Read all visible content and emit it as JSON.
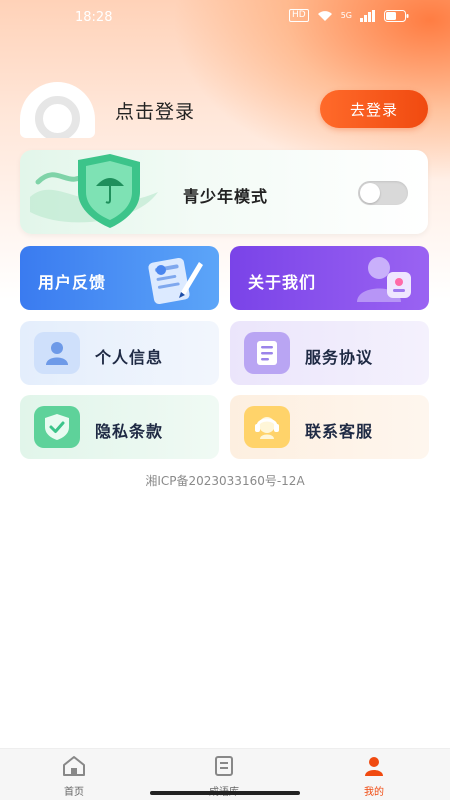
{
  "status_bar": {
    "time": "18:28",
    "hd_badge": "HD",
    "network_label": "5G"
  },
  "profile": {
    "login_prompt": "点击登录",
    "login_button": "去登录"
  },
  "youth_mode": {
    "label": "青少年模式",
    "enabled": false
  },
  "menu": {
    "feedback": "用户反馈",
    "about": "关于我们",
    "personal_info": "个人信息",
    "service_agreement": "服务协议",
    "privacy": "隐私条款",
    "contact": "联系客服"
  },
  "footer": {
    "icp": "湘ICP备2023033160号-12A"
  },
  "tabbar": {
    "items": [
      {
        "label": "首页",
        "icon": "home-icon",
        "active": false
      },
      {
        "label": "成语库",
        "icon": "book-icon",
        "active": false
      },
      {
        "label": "我的",
        "icon": "user-icon",
        "active": true
      }
    ]
  },
  "colors": {
    "accent": "#f04a10",
    "feedback_card": "#3a7bf0",
    "about_card": "#7a43e8"
  }
}
